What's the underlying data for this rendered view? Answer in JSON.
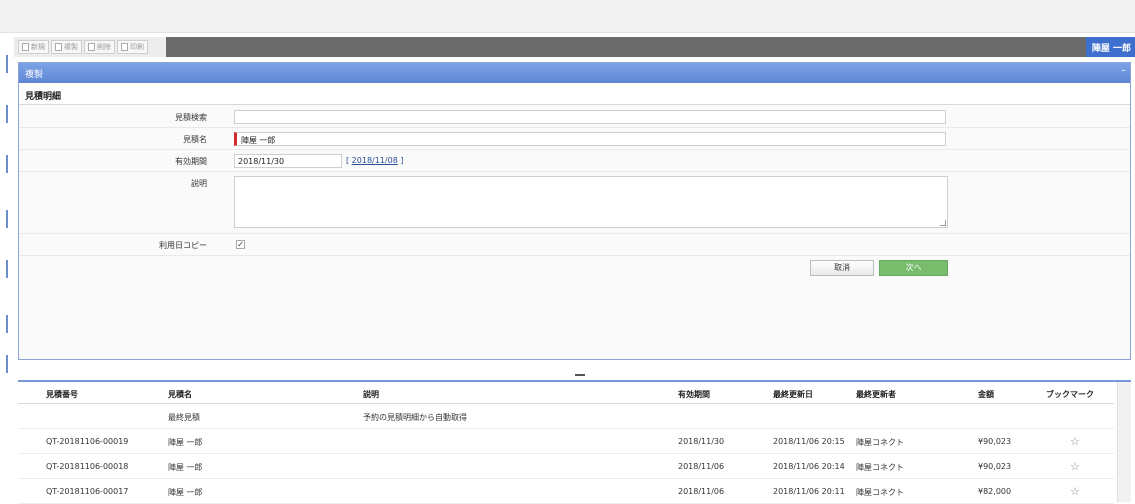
{
  "toolbar": {
    "buttons": [
      {
        "label": "新規",
        "icon": "new-doc-icon"
      },
      {
        "label": "複製",
        "icon": "copy-icon"
      },
      {
        "label": "削除",
        "icon": "delete-icon"
      },
      {
        "label": "印刷",
        "icon": "print-icon"
      }
    ],
    "user": "陣屋 一郎"
  },
  "panel": {
    "title": "複製",
    "minimize": "–",
    "section_title": "見積明細"
  },
  "form": {
    "search_label": "見積検索",
    "search_value": "",
    "name_label": "見積名",
    "name_value": "陣屋 一郎",
    "valid_label": "有効期間",
    "valid_value": "2018/11/30",
    "valid_ref_open": "[",
    "valid_ref": "2018/11/08",
    "valid_ref_close": "]",
    "desc_label": "説明",
    "desc_value": "",
    "copy_label": "利用日コピー",
    "copy_checked": true,
    "cancel_label": "取消",
    "next_label": "次へ"
  },
  "list": {
    "columns": [
      "見積番号",
      "見積名",
      "説明",
      "有効期間",
      "最終更新日",
      "最終更新者",
      "金額",
      "ブックマーク"
    ],
    "rows": [
      {
        "no": "",
        "name": "最終見積",
        "desc": "予約の見積明細から自動取得",
        "valid": "",
        "updated": "",
        "updater": "",
        "amount": "",
        "bookmark": ""
      },
      {
        "no": "QT-20181106-00019",
        "name": "陣屋 一郎",
        "desc": "",
        "valid": "2018/11/30",
        "updated": "2018/11/06 20:15",
        "updater": "陣屋コネクト",
        "amount": "¥90,023",
        "bookmark": "☆"
      },
      {
        "no": "QT-20181106-00018",
        "name": "陣屋 一郎",
        "desc": "",
        "valid": "2018/11/06",
        "updated": "2018/11/06 20:14",
        "updater": "陣屋コネクト",
        "amount": "¥90,023",
        "bookmark": "☆"
      },
      {
        "no": "QT-20181106-00017",
        "name": "陣屋 一郎",
        "desc": "",
        "valid": "2018/11/06",
        "updated": "2018/11/06 20:11",
        "updater": "陣屋コネクト",
        "amount": "¥82,000",
        "bookmark": "☆"
      }
    ]
  }
}
